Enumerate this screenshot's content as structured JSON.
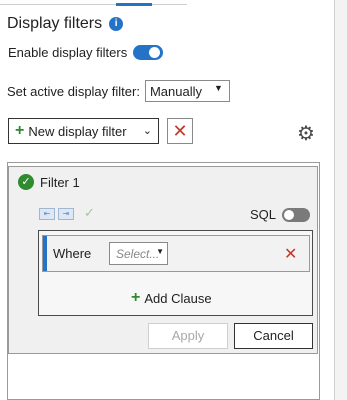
{
  "panel": {
    "title": "Display filters",
    "enable_label": "Enable display filters",
    "enable_on": true,
    "active_label": "Set active display filter:",
    "active_value": "Manually",
    "new_filter_label": "New display filter",
    "accent": "#2473c7"
  },
  "filter": {
    "name": "Filter 1",
    "sql_label": "SQL",
    "sql_on": false,
    "where_label": "Where",
    "field_placeholder": "Select...",
    "add_clause_label": "Add Clause",
    "apply_label": "Apply",
    "cancel_label": "Cancel"
  }
}
